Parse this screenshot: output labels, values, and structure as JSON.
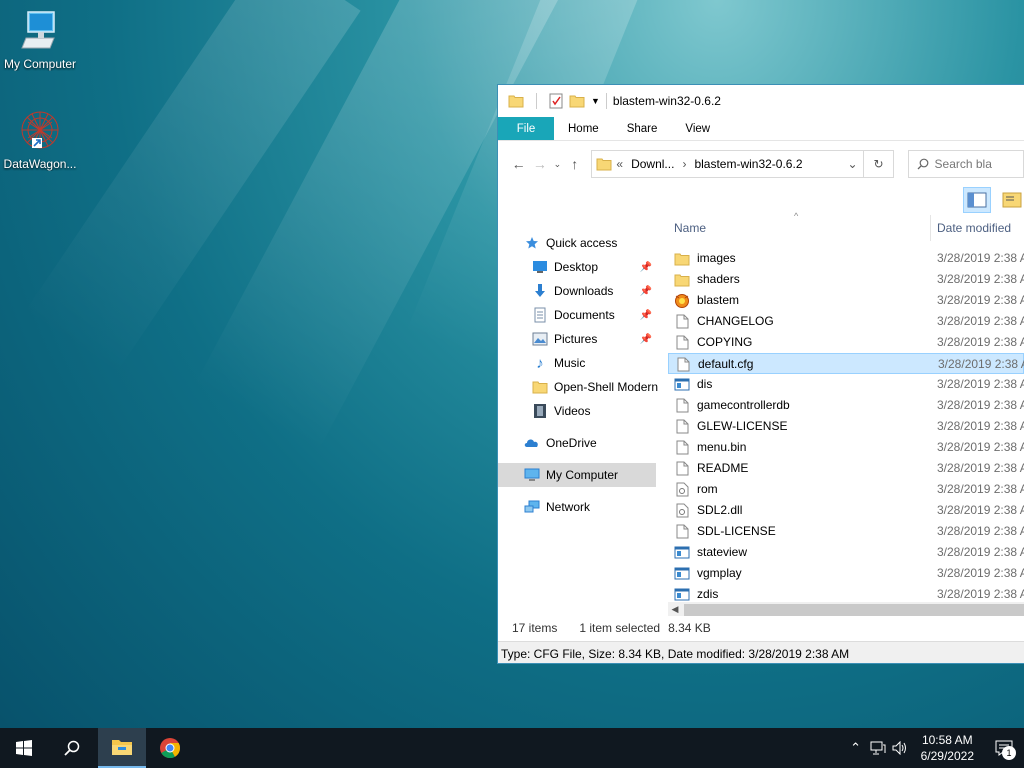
{
  "desktop": {
    "icons": [
      {
        "label": "My Computer"
      },
      {
        "label": "DataWagon..."
      }
    ]
  },
  "explorer": {
    "title": "blastem-win32-0.6.2",
    "ribbon_tabs": [
      "File",
      "Home",
      "Share",
      "View"
    ],
    "address": {
      "overflow": "«",
      "crumb1": "Downl...",
      "crumb2": "blastem-win32-0.6.2"
    },
    "search_placeholder": "Search bla",
    "nav_pane": [
      {
        "label": "Quick access",
        "icon": "star-icon"
      },
      {
        "label": "Desktop",
        "icon": "desktop-icon",
        "pinned": true
      },
      {
        "label": "Downloads",
        "icon": "download-icon",
        "pinned": true
      },
      {
        "label": "Documents",
        "icon": "documents-icon",
        "pinned": true
      },
      {
        "label": "Pictures",
        "icon": "pictures-icon",
        "pinned": true
      },
      {
        "label": "Music",
        "icon": "music-icon"
      },
      {
        "label": "Open-Shell Modern",
        "icon": "folder-icon"
      },
      {
        "label": "Videos",
        "icon": "videos-icon"
      },
      {
        "label": "OneDrive",
        "icon": "onedrive-icon"
      },
      {
        "label": "My Computer",
        "icon": "computer-icon",
        "selected": true
      },
      {
        "label": "Network",
        "icon": "network-icon"
      }
    ],
    "columns": {
      "name": "Name",
      "date": "Date modified"
    },
    "files": [
      {
        "name": "images",
        "type": "folder",
        "date": "3/28/2019 2:38 A"
      },
      {
        "name": "shaders",
        "type": "folder",
        "date": "3/28/2019 2:38 A"
      },
      {
        "name": "blastem",
        "type": "app",
        "date": "3/28/2019 2:38 A"
      },
      {
        "name": "CHANGELOG",
        "type": "file",
        "date": "3/28/2019 2:38 A"
      },
      {
        "name": "COPYING",
        "type": "file",
        "date": "3/28/2019 2:38 A"
      },
      {
        "name": "default.cfg",
        "type": "file",
        "date": "3/28/2019 2:38 A",
        "selected": true
      },
      {
        "name": "dis",
        "type": "exe",
        "date": "3/28/2019 2:38 A"
      },
      {
        "name": "gamecontrollerdb",
        "type": "file",
        "date": "3/28/2019 2:38 A"
      },
      {
        "name": "GLEW-LICENSE",
        "type": "file",
        "date": "3/28/2019 2:38 A"
      },
      {
        "name": "menu.bin",
        "type": "file",
        "date": "3/28/2019 2:38 A"
      },
      {
        "name": "README",
        "type": "file",
        "date": "3/28/2019 2:38 A"
      },
      {
        "name": "rom",
        "type": "dll",
        "date": "3/28/2019 2:38 A"
      },
      {
        "name": "SDL2.dll",
        "type": "dll",
        "date": "3/28/2019 2:38 A"
      },
      {
        "name": "SDL-LICENSE",
        "type": "file",
        "date": "3/28/2019 2:38 A"
      },
      {
        "name": "stateview",
        "type": "exe",
        "date": "3/28/2019 2:38 A"
      },
      {
        "name": "vgmplay",
        "type": "exe",
        "date": "3/28/2019 2:38 A"
      },
      {
        "name": "zdis",
        "type": "exe",
        "date": "3/28/2019 2:38 A"
      }
    ],
    "status": {
      "count": "17 items",
      "selected": "1 item selected",
      "size": "8.34 KB"
    },
    "info": "Type: CFG File, Size: 8.34 KB, Date modified: 3/28/2019 2:38 AM"
  },
  "taskbar": {
    "time": "10:58 AM",
    "date": "6/29/2022",
    "notifications": "1"
  },
  "colors": {
    "accent": "#19a6b8",
    "selection": "#cce8ff",
    "taskbar": "#101820"
  }
}
